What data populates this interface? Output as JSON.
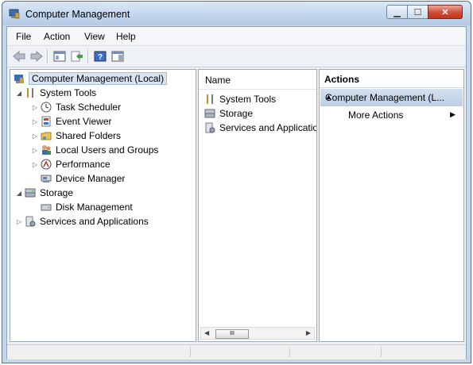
{
  "window": {
    "title": "Computer Management"
  },
  "menu": {
    "items": [
      {
        "label": "File"
      },
      {
        "label": "Action"
      },
      {
        "label": "View"
      },
      {
        "label": "Help"
      }
    ]
  },
  "tree": {
    "root": "Computer Management (Local)",
    "system_tools": "System Tools",
    "children": [
      {
        "label": "Task Scheduler"
      },
      {
        "label": "Event Viewer"
      },
      {
        "label": "Shared Folders"
      },
      {
        "label": "Local Users and Groups"
      },
      {
        "label": "Performance"
      },
      {
        "label": "Device Manager"
      }
    ],
    "storage": "Storage",
    "disk_management": "Disk Management",
    "services": "Services and Applications"
  },
  "list": {
    "header": "Name",
    "items": [
      {
        "label": "System Tools"
      },
      {
        "label": "Storage"
      },
      {
        "label": "Services and Applicatio"
      }
    ],
    "scroll_thumb": "III"
  },
  "actions": {
    "header": "Actions",
    "group": "Computer Management (L...",
    "more": "More Actions"
  }
}
